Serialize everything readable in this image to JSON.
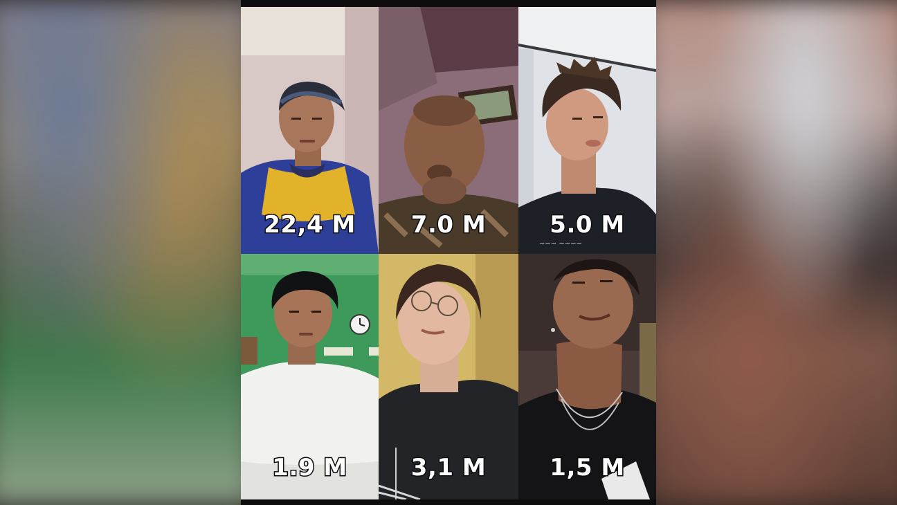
{
  "tiles": [
    {
      "label": "22,4 M"
    },
    {
      "label": "7.0 M"
    },
    {
      "label": "5.0 M"
    },
    {
      "label": "1.9 M"
    },
    {
      "label": "3,1 M"
    },
    {
      "label": "1,5 M"
    }
  ],
  "colors": {
    "label_text": "#ffffff",
    "label_outline": "#111111",
    "frame": "#0d0d0d"
  }
}
